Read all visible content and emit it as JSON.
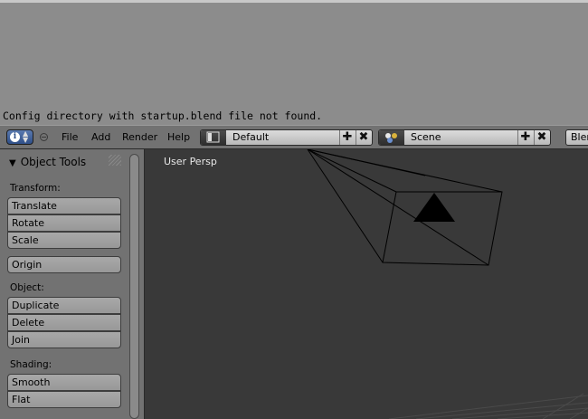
{
  "console": {
    "message": "Config directory with startup.blend file not found."
  },
  "header": {
    "editor_type_icon": "info-icon",
    "menus": [
      "File",
      "Add",
      "Render",
      "Help"
    ],
    "layout": {
      "value": "Default",
      "icon": "screen-layout-icon"
    },
    "scene": {
      "value": "Scene",
      "icon": "scene-icon"
    },
    "engine_partial": "Blen"
  },
  "tools": {
    "title": "Object Tools",
    "sections": {
      "transform": "Transform:",
      "object": "Object:",
      "shading": "Shading:"
    },
    "buttons": {
      "translate": "Translate",
      "rotate": "Rotate",
      "scale": "Scale",
      "origin": "Origin",
      "duplicate": "Duplicate",
      "delete": "Delete",
      "join": "Join",
      "smooth": "Smooth",
      "flat": "Flat"
    }
  },
  "viewport": {
    "view_name": "User Persp"
  },
  "colors": {
    "header": "#727272",
    "viewport_bg": "#393939",
    "editor_type_blue": "#3f5f98"
  }
}
